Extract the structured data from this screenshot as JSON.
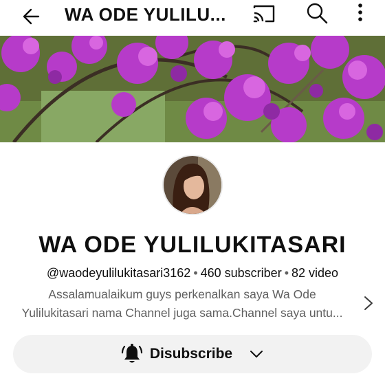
{
  "topbar": {
    "title": "WA ODE YULILU...",
    "icons": [
      "back-arrow-icon",
      "cast-icon",
      "search-icon",
      "more-vert-icon"
    ]
  },
  "channel": {
    "name": "WA ODE YULILUKITASARI",
    "handle": "@waodeyulilukitasari3162",
    "subscribers": "460 subscriber",
    "videos": "82 video",
    "separator": "•",
    "description_line1": "Assalamualaikum guys perkenalkan saya Wa Ode",
    "description_line2": "Yulilukitasari nama Channel juga sama.Channel saya untu..."
  },
  "subscribe_button": {
    "label": "Disubscribe",
    "icon": "bell-ring-icon"
  },
  "colors": {
    "text_primary": "#0f0f0f",
    "text_secondary": "#606060",
    "button_bg": "#f2f2f2",
    "flower": "#b63bc9"
  }
}
